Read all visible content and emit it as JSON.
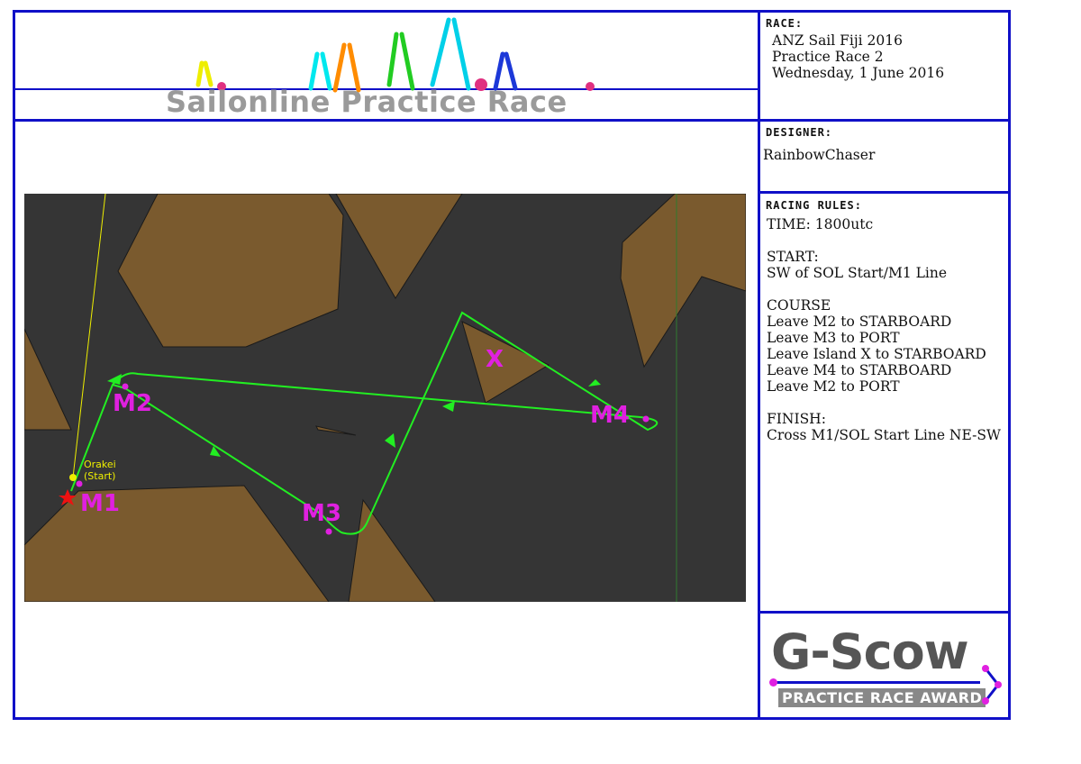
{
  "banner": {
    "title": "Sailonline Practice Race"
  },
  "race": {
    "label": "RACE:",
    "line1": "ANZ Sail Fiji 2016",
    "line2": "Practice Race 2",
    "line3": "Wednesday, 1 June 2016"
  },
  "designer": {
    "label": "DESIGNER:",
    "name": "RainbowChaser"
  },
  "rules": {
    "label": "RACING RULES:",
    "time": "TIME: 1800utc",
    "start_head": "START:",
    "start_text": "SW of SOL Start/M1 Line",
    "course_head": "COURSE",
    "course_items": [
      "Leave M2 to STARBOARD",
      "Leave M3 to PORT",
      "Leave Island X to STARBOARD",
      "Leave M4 to STARBOARD",
      "Leave M2 to PORT"
    ],
    "finish_head": "FINISH:",
    "finish_text": "Cross M1/SOL Start Line NE-SW"
  },
  "map": {
    "start_name": "Orakei",
    "start_sub": "(Start)",
    "marks": [
      "M1",
      "M2",
      "M3",
      "M4",
      "X"
    ],
    "colors": {
      "water": "#353535",
      "land": "#7a5a2e",
      "route": "#22ee22",
      "mark": "#e020e0",
      "start": "#ffff00"
    }
  },
  "award": {
    "brand": "G-Scow",
    "subtitle": "PRACTICE RACE AWARD"
  }
}
